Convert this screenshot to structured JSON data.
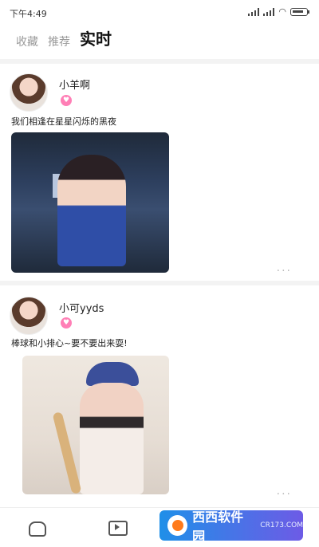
{
  "status_bar": {
    "time": "下午4:49",
    "icons": [
      "signal-icon",
      "signal-icon",
      "wifi-icon",
      "battery-icon"
    ]
  },
  "tabs": [
    {
      "label": "收藏",
      "active": false
    },
    {
      "label": "推荐",
      "active": false
    },
    {
      "label": "实时",
      "active": true
    }
  ],
  "posts": [
    {
      "username": "小羊啊",
      "caption": "我们相逢在星星闪烁的黑夜",
      "more": "···"
    },
    {
      "username": "小可yyds",
      "caption": "棒球和小排心~要不要出来耍!",
      "more": "···"
    }
  ],
  "bottom_nav": [
    "home-icon",
    "video-icon"
  ],
  "watermark": {
    "title": "西西软件园",
    "subtitle": "CR173.COM"
  },
  "colors": {
    "accent": "#ff7fb6",
    "tab_inactive": "#9a9a9a"
  }
}
